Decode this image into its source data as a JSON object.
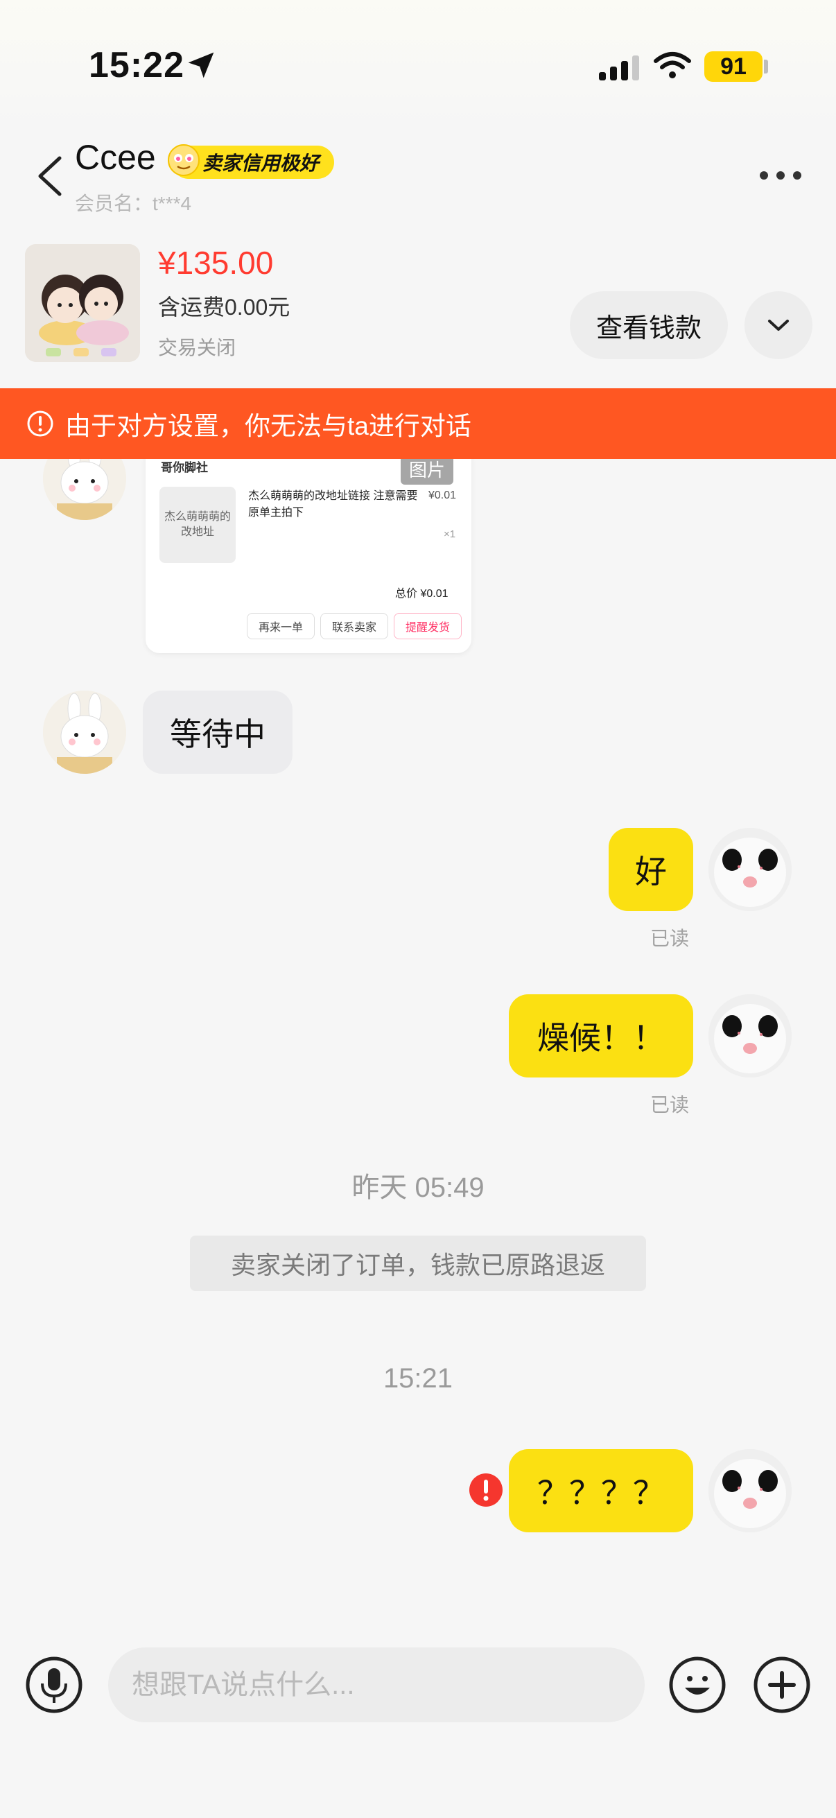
{
  "status_bar": {
    "time": "15:22",
    "battery": "91"
  },
  "header": {
    "name": "Ccee",
    "badge": "卖家信用极好",
    "member": "会员名：t***4"
  },
  "product": {
    "price": "¥135.00",
    "shipping": "含运费0.00元",
    "status": "交易关闭",
    "view_money": "查看钱款"
  },
  "warning": {
    "text": "由于对方设置，你无法与ta进行对话"
  },
  "shared_card": {
    "shop": "哥你脚社",
    "tag": "图片",
    "thumb_text": "杰么萌萌萌的改地址",
    "desc": "杰么萌萌萌的改地址链接 注意需要原单主拍下",
    "price": "¥0.01",
    "qty": "×1",
    "total": "总价 ¥0.01",
    "buttons": [
      "再来一单",
      "联系卖家",
      "提醒发货"
    ]
  },
  "messages": {
    "incoming_1": "等待中",
    "outgoing_1": "好",
    "read_1": "已读",
    "outgoing_2": "燥候！！",
    "read_2": "已读",
    "time_1": "昨天 05:49",
    "system": "卖家关闭了订单，钱款已原路退返",
    "time_2": "15:21",
    "outgoing_3": "？？？？"
  },
  "input": {
    "placeholder": "想跟TA说点什么..."
  },
  "colors": {
    "accent_yellow": "#fbe012",
    "warning_orange": "#ff5722",
    "price_red": "#ff3b30"
  }
}
